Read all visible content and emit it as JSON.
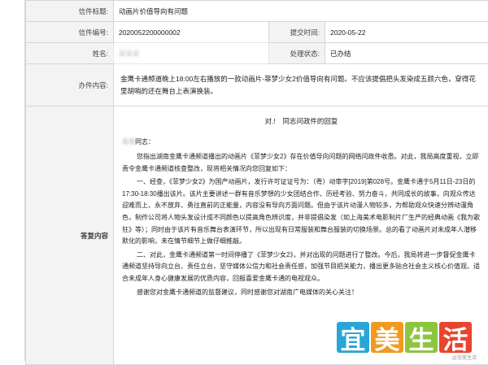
{
  "fields": {
    "title_label": "信件标题:",
    "title_value": "动画片价值导向有问题",
    "number_label": "信件编号:",
    "number_value": "2020052200000002",
    "submit_time_label": "提交时间:",
    "submit_time_value": "2020-05-22",
    "name_label": "姓名:",
    "name_value": "某某某",
    "status_label": "处理状态:",
    "status_value": "已办结",
    "content_label": "办件内容:",
    "content_value": "金鹰卡通频道晚上18:00左右播放的一款动画片-菲梦少女2价值导向有问题。不应该提倡把头发染成五颜六色，穿得花里胡哨的还在舞台上表演换装。",
    "reply_label": "答复内容"
  },
  "reply": {
    "title": "对.!　同志问政件的回复",
    "greeting_name": "某某",
    "greeting_suffix": "同志：",
    "paragraphs": [
      "您指出湖南金鹰卡通频道播出的动画片《菲梦少女2》存在价值导向问题的网络问政件收悉。对此，我局高度重视，立即责令金鹰卡通频道核查整改，现将相关情况向您回复如下：",
      "一、经查，《菲梦少女2》为国产动画片，发行许可证证号为：（粤）动审字[2019]第028号。金鹰卡通于5月11日-23日的17:30-18:30播出该片。该片主要讲述一群有音乐梦想的少女团结合作、历经考验、努力奋斗，共同成长的故事，向观众传达迎难而上、永不放弃、勇往直前的正能量，内容没有导向方面问题。但由于该片动漫人物较多，为帮助观众快速分辨动漫角色，制作公司将人物头发设计成不同颜色以提高角色辨识度，并非提倡染发（如上海美术电影制片厂生产的经典动画《我为歌狂》等）；同时由于该片有音乐舞台表演环节，所以出现有日常服装和舞台服装的切换场景。总的看了动画片对未成年人潜移默化的影响，未在情节细节上做仔细推敲。",
      "二、对此，金鹰卡通频道第一时间停播了《菲梦少女2》，并对出现的问题进行了整改。今后，我局将进一步督促金鹰卡通频道坚持导向立台、责任立台，坚守媒体公信力和社会责任感，加强节目把关能力，播出更多贴合社会主义核心价值观、适合未成年人身心健康发展的优质内容，回报喜爱金鹰卡通的电视观众。",
      "感谢您对金鹰卡通频道的监督建议，同时感谢您对湖南广电媒体的关心关注！"
    ]
  },
  "watermark": {
    "chars": [
      "宜",
      "美",
      "生",
      "活"
    ],
    "colors": [
      "#2aa6d6",
      "#f29a1f",
      "#8cc63f",
      "#e8442e"
    ],
    "note": "@宜美生活"
  }
}
